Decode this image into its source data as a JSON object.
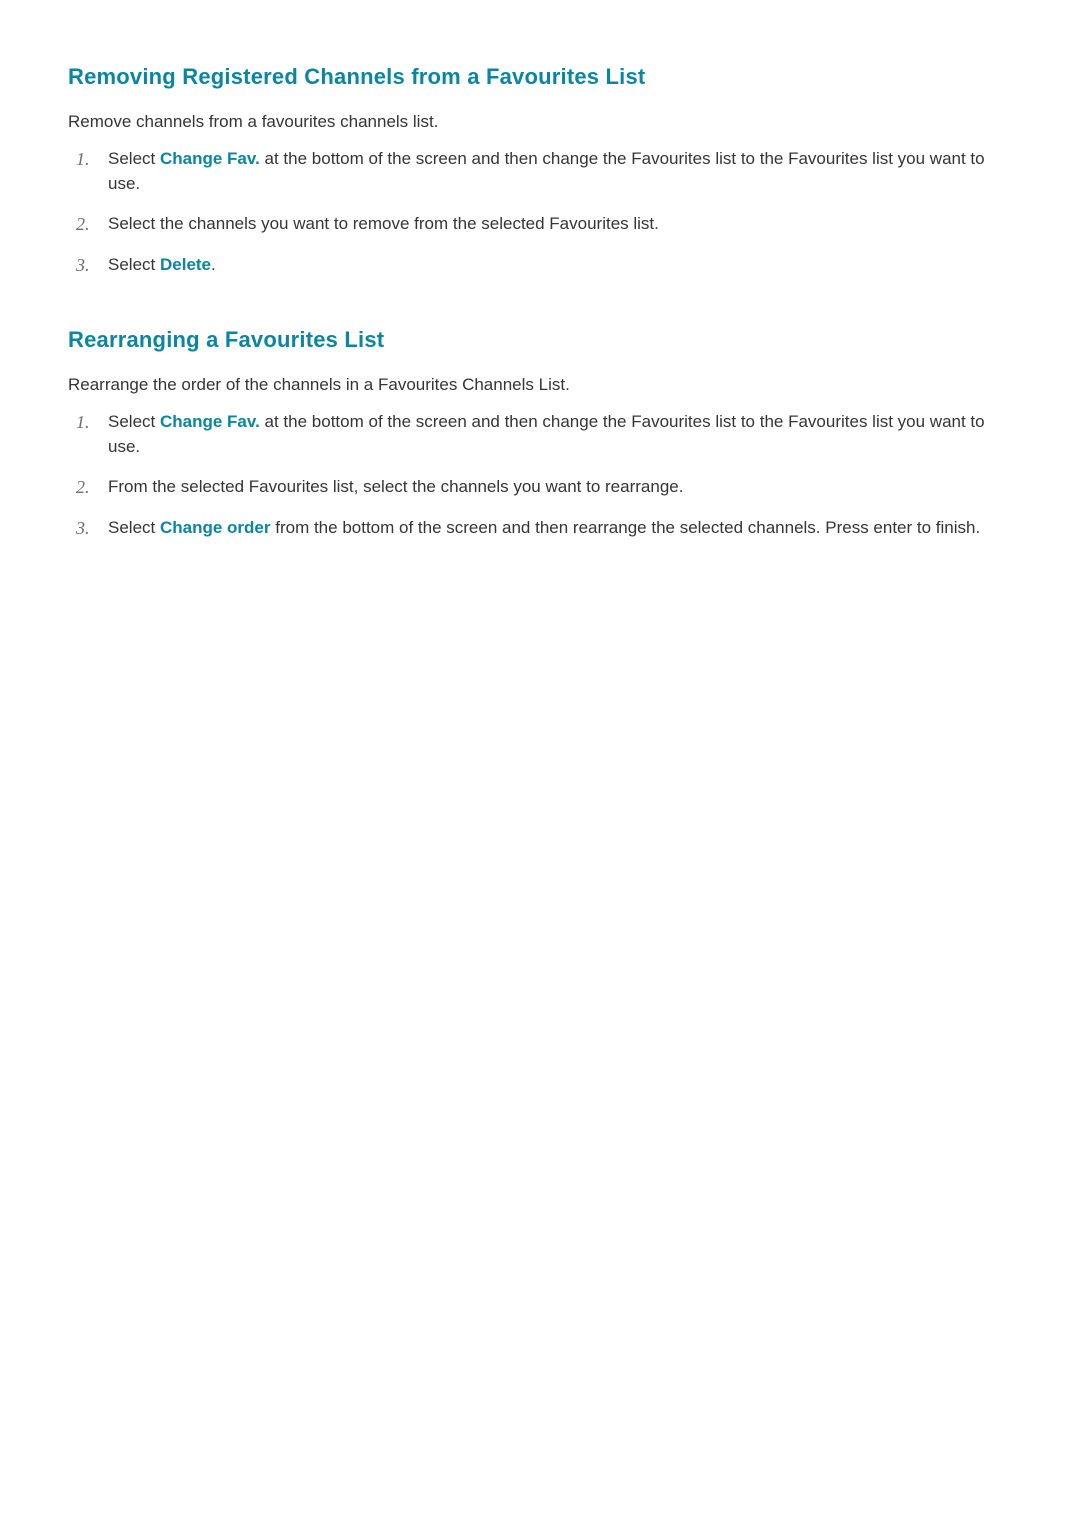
{
  "sections": [
    {
      "title": "Removing Registered Channels from a Favourites List",
      "intro": "Remove channels from a favourites channels list.",
      "steps": [
        {
          "num": "1.",
          "parts": [
            {
              "type": "text",
              "value": "Select "
            },
            {
              "type": "label",
              "value": "Change Fav."
            },
            {
              "type": "text",
              "value": " at the bottom of the screen and then change the Favourites list to the Favourites list you want to use."
            }
          ]
        },
        {
          "num": "2.",
          "parts": [
            {
              "type": "text",
              "value": "Select the channels you want to remove from the selected Favourites list."
            }
          ]
        },
        {
          "num": "3.",
          "parts": [
            {
              "type": "text",
              "value": "Select "
            },
            {
              "type": "label",
              "value": "Delete"
            },
            {
              "type": "text",
              "value": "."
            }
          ]
        }
      ]
    },
    {
      "title": "Rearranging a Favourites List",
      "intro": "Rearrange the order of the channels in a Favourites Channels List.",
      "steps": [
        {
          "num": "1.",
          "parts": [
            {
              "type": "text",
              "value": "Select "
            },
            {
              "type": "label",
              "value": "Change Fav."
            },
            {
              "type": "text",
              "value": " at the bottom of the screen and then change the Favourites list to the Favourites list you want to use."
            }
          ]
        },
        {
          "num": "2.",
          "parts": [
            {
              "type": "text",
              "value": "From the selected Favourites list, select the channels you want to rearrange."
            }
          ]
        },
        {
          "num": "3.",
          "parts": [
            {
              "type": "text",
              "value": "Select "
            },
            {
              "type": "label",
              "value": "Change order"
            },
            {
              "type": "text",
              "value": " from the bottom of the screen and then rearrange the selected channels. Press enter to finish."
            }
          ]
        }
      ]
    }
  ]
}
